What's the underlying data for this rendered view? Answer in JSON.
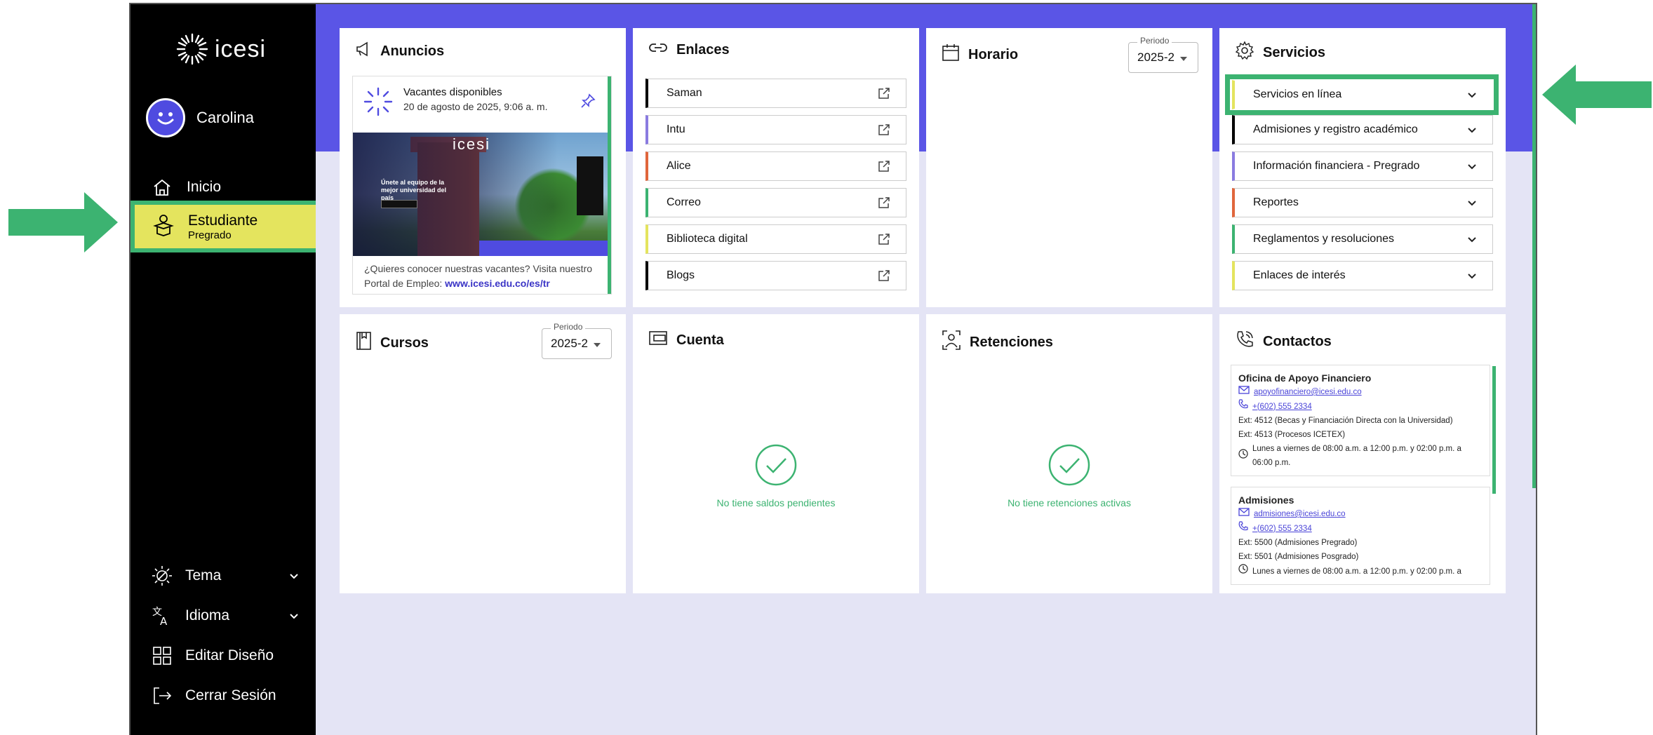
{
  "sidebar": {
    "logo_text": "icesi",
    "user_name": "Carolina",
    "nav": [
      {
        "label": "Inicio",
        "icon": "home-icon"
      },
      {
        "label": "Estudiante",
        "sublabel": "Pregrado",
        "icon": "student-icon"
      }
    ],
    "bottom": [
      {
        "label": "Tema",
        "icon": "theme-icon"
      },
      {
        "label": "Idioma",
        "icon": "language-icon"
      },
      {
        "label": "Editar Diseño",
        "icon": "layout-icon"
      },
      {
        "label": "Cerrar Sesión",
        "icon": "logout-icon"
      }
    ]
  },
  "anuncios": {
    "title": "Anuncios",
    "item_title": "Vacantes disponibles",
    "item_date": "20 de agosto de 2025, 9:06 a. m.",
    "image_brand": "icesi",
    "image_headline": "Únete al equipo de la mejor universidad del país",
    "text": "¿Quieres conocer nuestras vacantes? Visita nuestro Portal de Empleo: ",
    "link": "www.icesi.edu.co/es/tr"
  },
  "enlaces": {
    "title": "Enlaces",
    "items": [
      {
        "label": "Saman",
        "color": "#000000"
      },
      {
        "label": "Intu",
        "color": "#8a7be0"
      },
      {
        "label": "Alice",
        "color": "#e0663c"
      },
      {
        "label": "Correo",
        "color": "#3cb371"
      },
      {
        "label": "Biblioteca digital",
        "color": "#e4e45e"
      },
      {
        "label": "Blogs",
        "color": "#000000"
      }
    ]
  },
  "horario": {
    "title": "Horario",
    "period_label": "Periodo",
    "period_value": "2025-2"
  },
  "servicios": {
    "title": "Servicios",
    "items": [
      {
        "label": "Servicios en línea",
        "color": "#e4e45e"
      },
      {
        "label": "Admisiones y registro académico",
        "color": "#000000"
      },
      {
        "label": "Información financiera - Pregrado",
        "color": "#8a7be0"
      },
      {
        "label": "Reportes",
        "color": "#e0663c"
      },
      {
        "label": "Reglamentos y resoluciones",
        "color": "#3cb371"
      },
      {
        "label": "Enlaces de interés",
        "color": "#e4e45e"
      }
    ]
  },
  "cursos": {
    "title": "Cursos",
    "period_label": "Periodo",
    "period_value": "2025-2"
  },
  "cuenta": {
    "title": "Cuenta",
    "status": "No tiene saldos pendientes"
  },
  "retenciones": {
    "title": "Retenciones",
    "status": "No tiene retenciones activas"
  },
  "contactos": {
    "title": "Contactos",
    "items": [
      {
        "name": "Oficina de Apoyo Financiero",
        "email": "apoyofinanciero@icesi.edu.co",
        "phone": "+(602) 555 2334",
        "ext1": "Ext: 4512 (Becas y Financiación Directa con la Universidad)",
        "ext2": "Ext: 4513 (Procesos ICETEX)",
        "hours": "Lunes a viernes de 08:00 a.m. a 12:00 p.m. y 02:00 p.m. a 06:00 p.m."
      },
      {
        "name": "Admisiones",
        "email": "admisiones@icesi.edu.co",
        "phone": "+(602) 555 2334",
        "ext1": "Ext: 5500 (Admisiones Pregrado)",
        "ext2": "Ext: 5501 (Admisiones Posgrado)",
        "hours": "Lunes a viernes de 08:00 a.m. a 12:00 p.m. y 02:00 p.m. a"
      }
    ]
  },
  "colors": {
    "accent": "#5a55e6",
    "highlight": "#3cb371",
    "active_nav": "#e4e45e"
  }
}
